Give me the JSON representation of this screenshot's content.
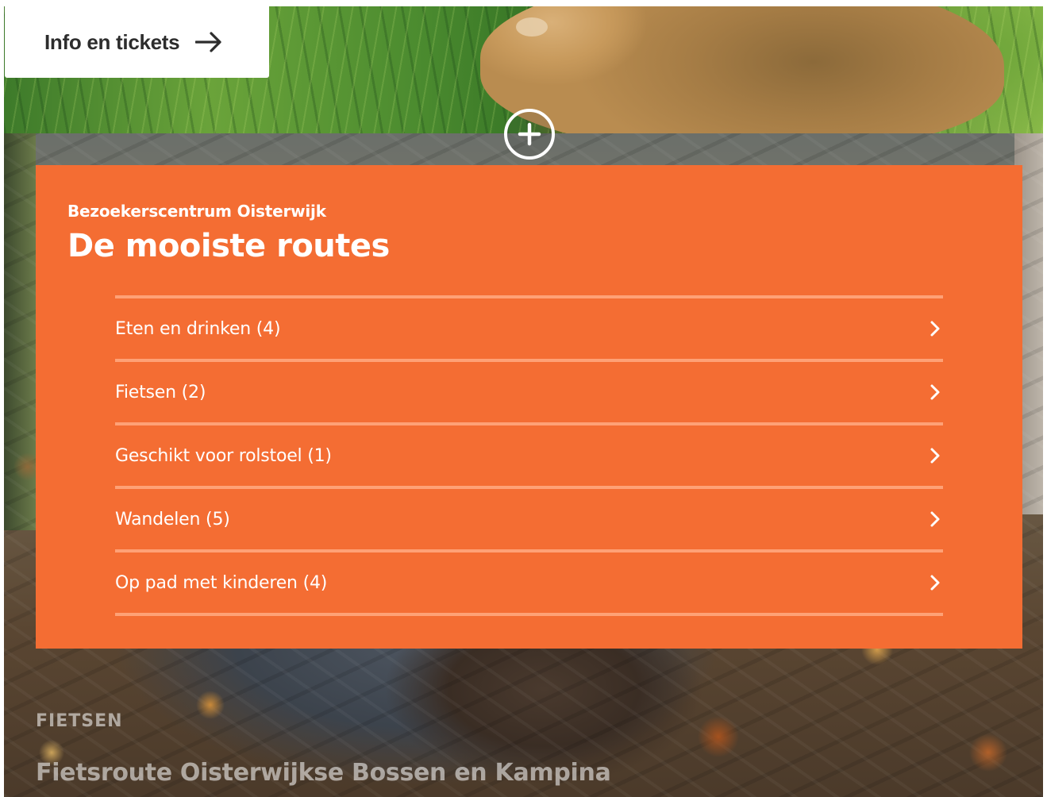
{
  "header": {
    "info_button_label": "Info en tickets"
  },
  "panel": {
    "subtitle": "Bezoekerscentrum Oisterwijk",
    "title": "De mooiste routes",
    "routes": [
      {
        "label": "Eten en drinken (4)"
      },
      {
        "label": "Fietsen (2)"
      },
      {
        "label": "Geschikt voor rolstoel (1)"
      },
      {
        "label": "Wandelen (5)"
      },
      {
        "label": "Op pad met kinderen (4)"
      }
    ],
    "accent_color": "#f46d33"
  },
  "caption": {
    "kicker": "Fietsen",
    "title": "Fietsroute Oisterwijkse Bossen en Kampina"
  },
  "icons": {
    "info_arrow": "arrow-right-icon",
    "expand": "plus-circle-icon",
    "route_chevron": "chevron-right-icon"
  }
}
